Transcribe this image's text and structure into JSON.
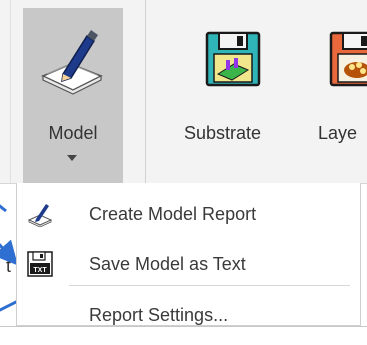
{
  "ribbon": {
    "model_button": {
      "label": "Model",
      "icon": "model-report-icon"
    },
    "buttons": [
      {
        "label": "Substrate",
        "icon": "substrate-floppy-icon"
      },
      {
        "label": "Laye",
        "icon": "layer-floppy-icon"
      }
    ]
  },
  "dropdown": {
    "items": [
      {
        "label": "Create Model Report",
        "icon": "create-report-icon"
      },
      {
        "label": "Save Model as Text",
        "icon": "save-text-icon"
      },
      {
        "label": "Report Settings...",
        "icon": ""
      }
    ]
  },
  "background_text": {
    "stray_letter": "t"
  },
  "colors": {
    "ribbon_bg": "#f3f3f3",
    "selected_button_bg": "#c8c8c8",
    "annotation_arrow": "#2e6fd1",
    "floppy_teal": "#2fb5b8",
    "floppy_orange": "#e9693c"
  }
}
